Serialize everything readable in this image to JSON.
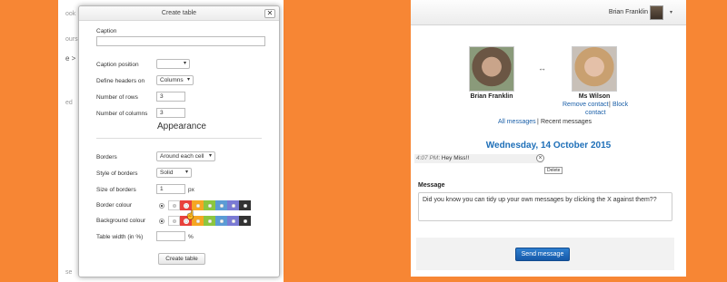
{
  "background_color": "#f78634",
  "left_page": {
    "ghost_texts": [
      "ook",
      "ourse",
      "e >",
      "ed",
      "se"
    ]
  },
  "dialog": {
    "title": "Create table",
    "close_symbol": "✕",
    "caption_label": "Caption",
    "caption_value": "",
    "caption_position_label": "Caption position",
    "caption_position_value": "",
    "define_headers_label": "Define headers on",
    "define_headers_value": "Columns",
    "rows_label": "Number of rows",
    "rows_value": "3",
    "columns_label": "Number of columns",
    "columns_value": "3",
    "appearance_heading": "Appearance",
    "borders_label": "Borders",
    "borders_value": "Around each cell",
    "border_style_label": "Style of borders",
    "border_style_value": "Solid",
    "border_size_label": "Size of borders",
    "border_size_value": "1",
    "border_size_unit": "px",
    "border_colour_label": "Border colour",
    "background_colour_label": "Background colour",
    "table_width_label": "Table width (in %)",
    "table_width_value": "",
    "table_width_unit": "%",
    "create_button": "Create table",
    "swatch_colors": [
      "#ffffff",
      "#e8413c",
      "#f5a623",
      "#8cc63f",
      "#5b9bd5",
      "#7a7ad4",
      "#333333"
    ],
    "border_selected_index": 1,
    "background_selected_index": 1
  },
  "messages": {
    "nav_user": "Brian Franklin",
    "user1_name": "Brian Franklin",
    "user2_name": "Ms Wilson",
    "remove_contact": "Remove contact",
    "separator": "|",
    "block": "Block",
    "contact": "contact",
    "all_messages": "All messages",
    "recent_messages": "Recent messages",
    "date": "Wednesday, 14 October 2015",
    "msg_time": "4:07 PM",
    "msg_text": ": Hey Miss!!",
    "delete_tooltip": "Delete",
    "message_label": "Message",
    "message_value": "Did you know you can tidy up your own messages by clicking the X against them??",
    "send_button": "Send message"
  }
}
